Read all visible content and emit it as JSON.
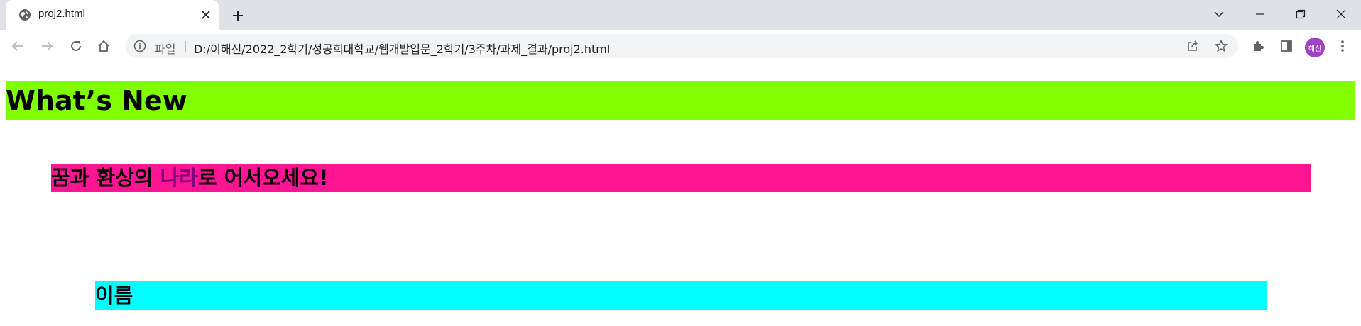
{
  "browser": {
    "tab": {
      "title": "proj2.html",
      "favicon": "globe-icon"
    },
    "address_bar": {
      "scheme_label": "파일",
      "separator": "|",
      "url": "D:/이해신/2022_2학기/성공회대학교/웹개발입문_2학기/3주차/과제_결과/proj2.html"
    },
    "profile": {
      "initials": "해신",
      "color": "#a142c3"
    },
    "icons": {
      "back": "arrow-left-icon",
      "forward": "arrow-right-icon",
      "reload": "reload-icon",
      "home": "home-icon",
      "share": "share-icon",
      "bookmark": "star-icon",
      "extensions": "puzzle-icon",
      "side_panel": "side-panel-icon",
      "menu": "kebab-menu-icon"
    }
  },
  "page": {
    "heading_1": {
      "text": "What’s New",
      "background": "#7fff00"
    },
    "heading_2": {
      "text_before": "꿈과 환상의 ",
      "highlight": "나라",
      "text_after": "로 어서오세요!",
      "background": "#ff1493",
      "highlight_color": "#800080"
    },
    "heading_3": {
      "text": "이름",
      "background": "#00ffff"
    }
  }
}
